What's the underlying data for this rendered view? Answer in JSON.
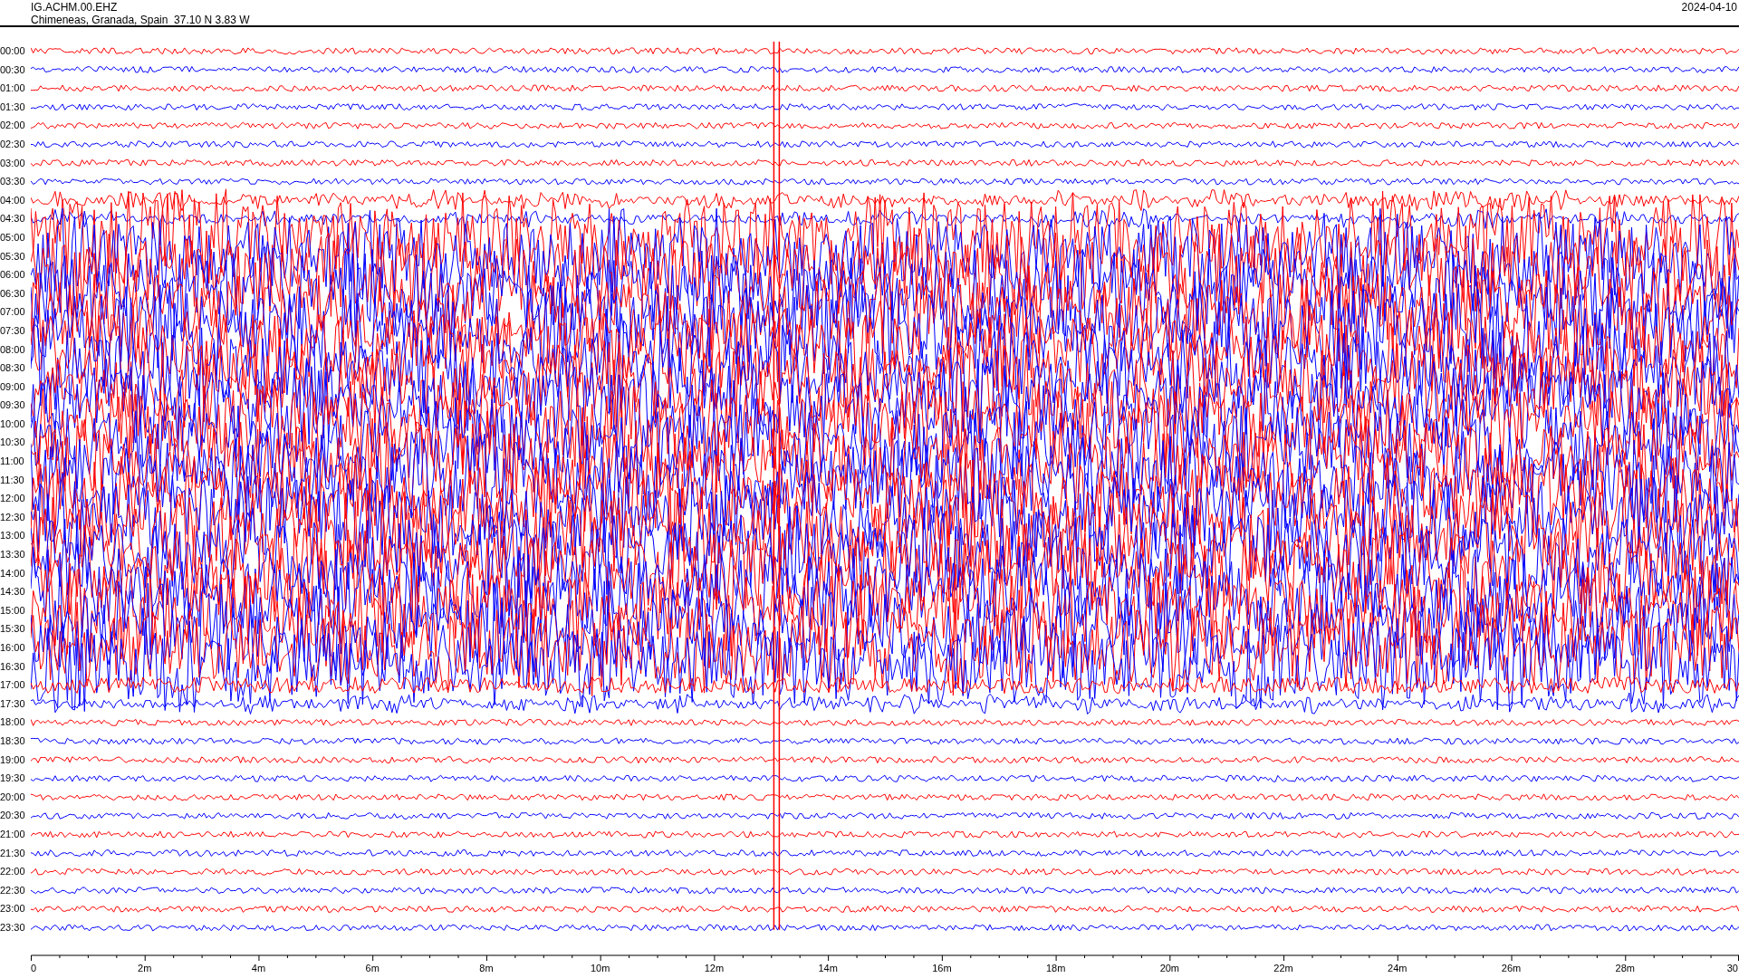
{
  "header": {
    "station": "IG.ACHM.00.EHZ",
    "location": "Chimeneas, Granada, Spain  37.10 N 3.83 W",
    "date": "2024-04-10"
  },
  "rows": [
    {
      "label": "00:00",
      "color": "#ff0000"
    },
    {
      "label": "00:30",
      "color": "#0000ff"
    },
    {
      "label": "01:00",
      "color": "#ff0000"
    },
    {
      "label": "01:30",
      "color": "#0000ff"
    },
    {
      "label": "02:00",
      "color": "#ff0000"
    },
    {
      "label": "02:30",
      "color": "#0000ff"
    },
    {
      "label": "03:00",
      "color": "#ff0000"
    },
    {
      "label": "03:30",
      "color": "#0000ff"
    },
    {
      "label": "04:00",
      "color": "#ff0000"
    },
    {
      "label": "04:30",
      "color": "#0000ff"
    },
    {
      "label": "05:00",
      "color": "#ff0000"
    },
    {
      "label": "05:30",
      "color": "#0000ff"
    },
    {
      "label": "06:00",
      "color": "#ff0000"
    },
    {
      "label": "06:30",
      "color": "#0000ff"
    },
    {
      "label": "07:00",
      "color": "#ff0000"
    },
    {
      "label": "07:30",
      "color": "#0000ff"
    },
    {
      "label": "08:00",
      "color": "#ff0000"
    },
    {
      "label": "08:30",
      "color": "#0000ff"
    },
    {
      "label": "09:00",
      "color": "#ff0000"
    },
    {
      "label": "09:30",
      "color": "#0000ff"
    },
    {
      "label": "10:00",
      "color": "#ff0000"
    },
    {
      "label": "10:30",
      "color": "#0000ff"
    },
    {
      "label": "11:00",
      "color": "#ff0000"
    },
    {
      "label": "11:30",
      "color": "#0000ff"
    },
    {
      "label": "12:00",
      "color": "#ff0000"
    },
    {
      "label": "12:30",
      "color": "#0000ff"
    },
    {
      "label": "13:00",
      "color": "#ff0000"
    },
    {
      "label": "13:30",
      "color": "#0000ff"
    },
    {
      "label": "14:00",
      "color": "#ff0000"
    },
    {
      "label": "14:30",
      "color": "#0000ff"
    },
    {
      "label": "15:00",
      "color": "#ff0000"
    },
    {
      "label": "15:30",
      "color": "#0000ff"
    },
    {
      "label": "16:00",
      "color": "#ff0000"
    },
    {
      "label": "16:30",
      "color": "#0000ff"
    },
    {
      "label": "17:00",
      "color": "#ff0000"
    },
    {
      "label": "17:30",
      "color": "#0000ff"
    },
    {
      "label": "18:00",
      "color": "#ff0000"
    },
    {
      "label": "18:30",
      "color": "#0000ff"
    },
    {
      "label": "19:00",
      "color": "#ff0000"
    },
    {
      "label": "19:30",
      "color": "#0000ff"
    },
    {
      "label": "20:00",
      "color": "#ff0000"
    },
    {
      "label": "20:30",
      "color": "#0000ff"
    },
    {
      "label": "21:00",
      "color": "#ff0000"
    },
    {
      "label": "21:30",
      "color": "#0000ff"
    },
    {
      "label": "22:00",
      "color": "#ff0000"
    },
    {
      "label": "22:30",
      "color": "#0000ff"
    },
    {
      "label": "23:00",
      "color": "#ff0000"
    },
    {
      "label": "23:30",
      "color": "#0000ff"
    }
  ],
  "x_axis": {
    "ticks": [
      "0",
      "2m",
      "4m",
      "6m",
      "8m",
      "10m",
      "12m",
      "14m",
      "16m",
      "18m",
      "20m",
      "22m",
      "24m",
      "26m",
      "28m",
      "30"
    ]
  }
}
